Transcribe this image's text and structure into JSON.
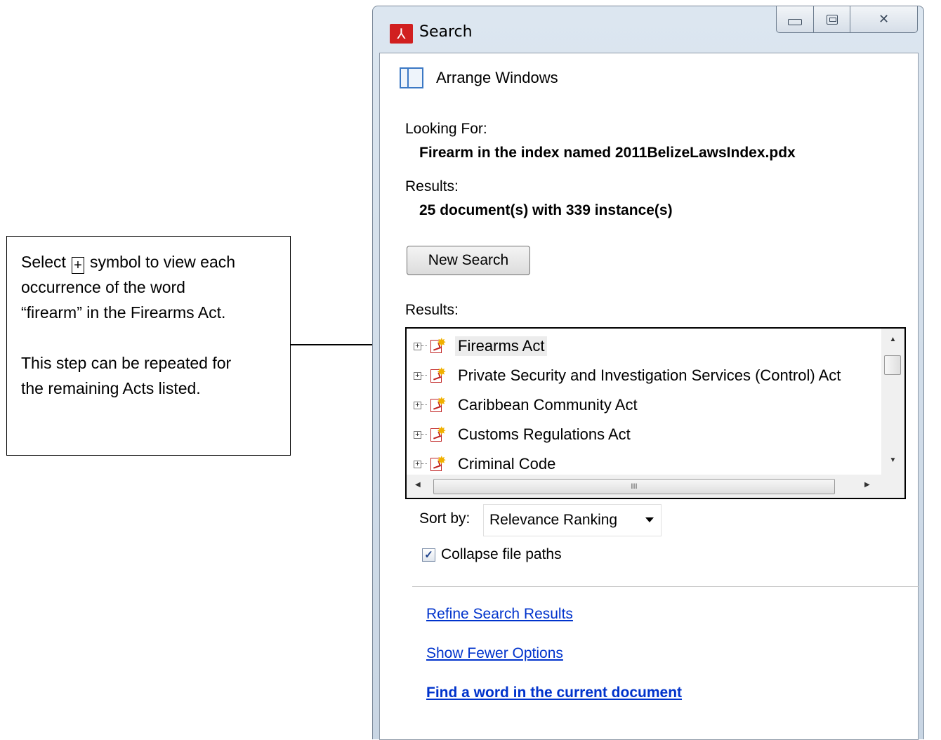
{
  "annotation": {
    "line1_prefix": "Select",
    "plus_symbol": "+",
    "line1_suffix": "symbol to view each",
    "line2": "occurrence of the word",
    "line3": "“firearm” in the Firearms Act.",
    "line4": "This step can be repeated for",
    "line5": "the remaining Acts listed."
  },
  "window": {
    "title": "Search",
    "app_icon": "adobe-reader-icon",
    "controls": [
      "minimize-icon",
      "maximize-icon",
      "close-icon"
    ],
    "close_glyph": "✕"
  },
  "arrange": {
    "label": "Arrange Windows",
    "icon": "arrange-windows-icon"
  },
  "looking_for": {
    "label": "Looking For:",
    "value": "Firearm in the index named 2011BelizeLawsIndex.pdx"
  },
  "summary": {
    "label": "Results:",
    "value": "25 document(s) with 339 instance(s)"
  },
  "new_search": {
    "label": "New Search"
  },
  "results": {
    "label": "Results:",
    "items": [
      {
        "label": "Firearms Act",
        "expander": "+",
        "selected": true
      },
      {
        "label": "Private Security and Investigation Services (Control) Act",
        "expander": "+",
        "selected": false
      },
      {
        "label": "Caribbean Community Act",
        "expander": "+",
        "selected": false
      },
      {
        "label": "Customs Regulations Act",
        "expander": "+",
        "selected": false
      },
      {
        "label": "Criminal Code",
        "expander": "+",
        "selected": false
      }
    ],
    "scroll_up": "▲",
    "scroll_down": "▼",
    "scroll_left": "◀",
    "scroll_right": "▶",
    "hthumb_grip": "III"
  },
  "sort": {
    "label": "Sort by:",
    "selected": "Relevance Ranking"
  },
  "collapse": {
    "label": "Collapse file paths",
    "checked": true,
    "check_glyph": "✓"
  },
  "links": {
    "refine": "Refine Search Results",
    "fewer": "Show Fewer Options",
    "find_word": "Find a word in the current document"
  },
  "colors": {
    "link": "#0033cc",
    "title_icon": "#d11f1f",
    "accent": "#3b78c4"
  }
}
